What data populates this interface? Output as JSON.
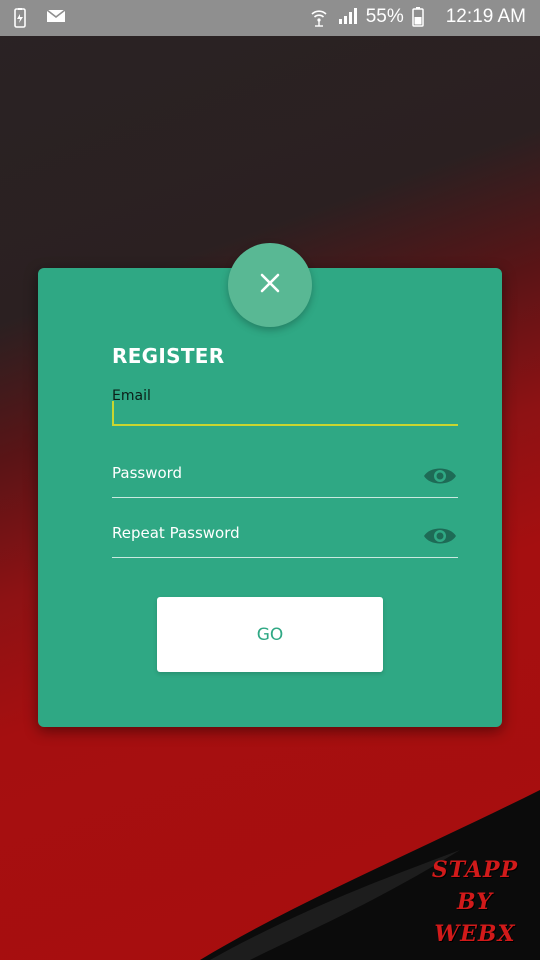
{
  "status_bar": {
    "battery_percent": "55%",
    "time": "12:19 AM",
    "icons": [
      "battery-saver-icon",
      "mail-icon",
      "wifi-icon",
      "signal-icon",
      "battery-icon"
    ]
  },
  "form": {
    "title": "REGISTER",
    "email_label": "Email",
    "email_value": "",
    "password_label": "Password",
    "password_value": "",
    "repeat_password_label": "Repeat Password",
    "repeat_password_value": "",
    "go_label": "GO",
    "close_icon": "close-icon",
    "eye_icon": "eye-icon"
  },
  "watermark": {
    "line1": "STAPP",
    "line2": "BY",
    "line3": "WEBX"
  },
  "colors": {
    "card": "#2fa884",
    "fab": "#59b894",
    "accent_underline": "#c8d630",
    "background_red": "#a80e0e",
    "background_dark": "#2a2324",
    "eye": "#1e6b56"
  }
}
